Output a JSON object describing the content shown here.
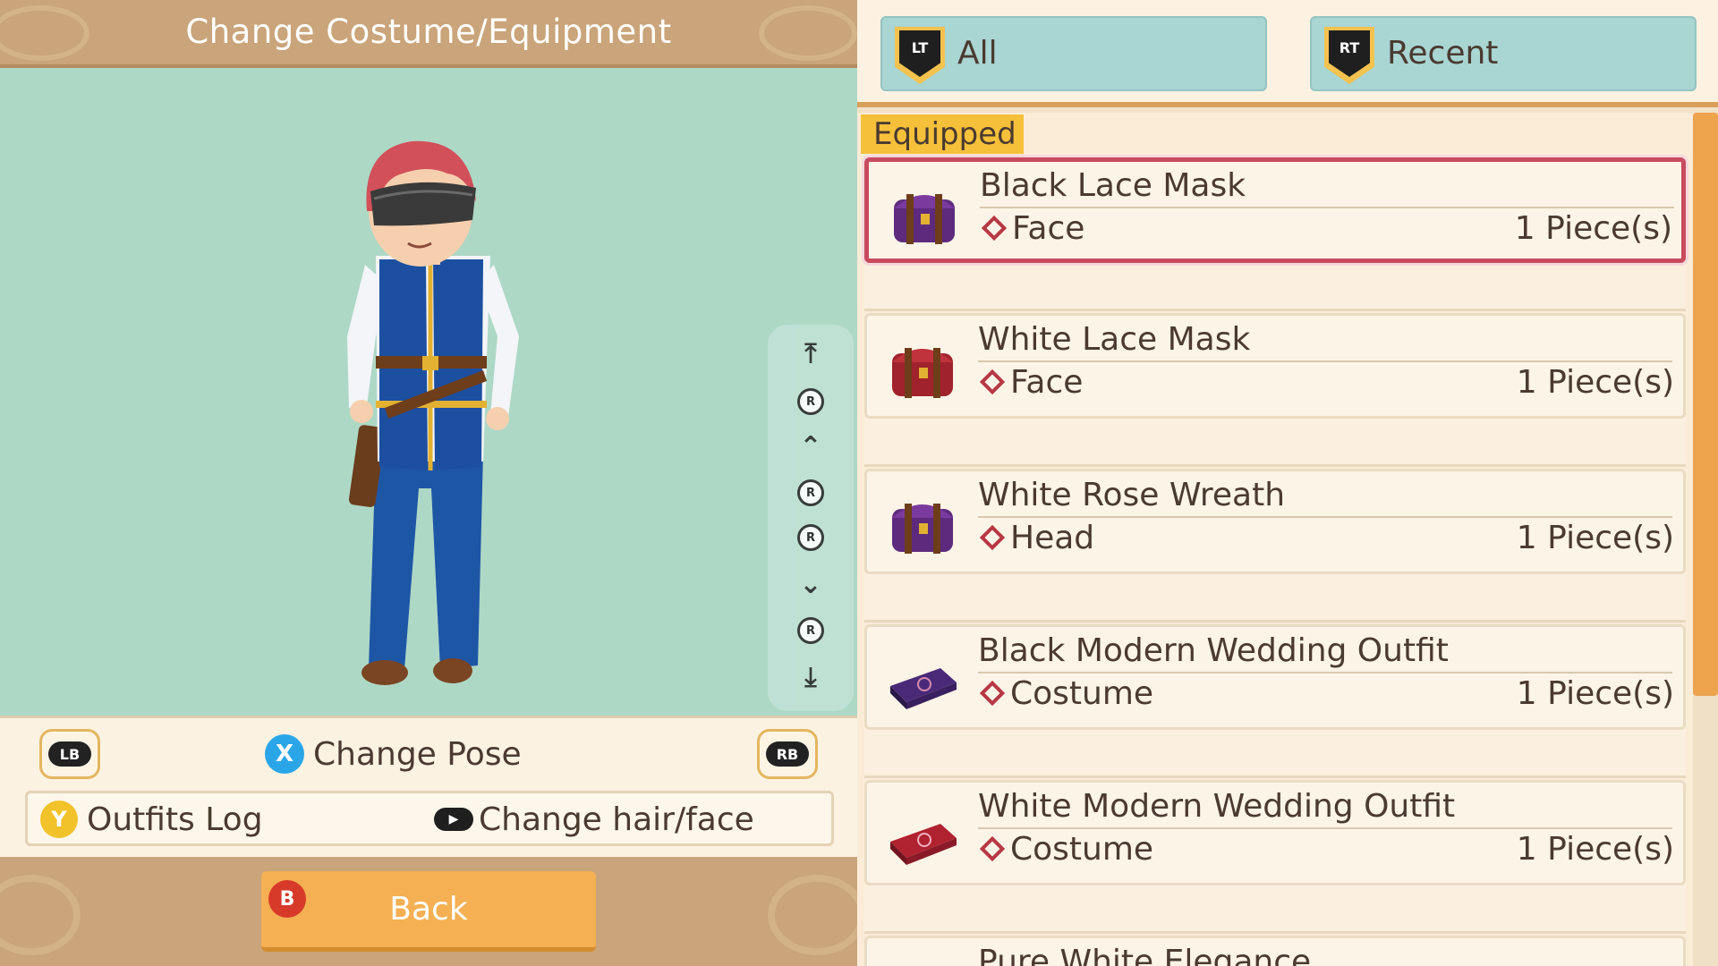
{
  "header": {
    "title": "Change Costume/Equipment"
  },
  "viewer": {
    "scroll_controls": [
      "scroll-to-top",
      "rotate-up",
      "zoom-in",
      "rotate-left",
      "rotate-right",
      "zoom-out",
      "rotate-down",
      "scroll-to-bottom"
    ],
    "r_label": "R"
  },
  "controls": {
    "lb": "LB",
    "rb": "RB",
    "x_button": "X",
    "change_pose": "Change Pose",
    "y_button": "Y",
    "outfits_log": "Outfits Log",
    "change_hair_face": "Change hair/face",
    "b_button": "B",
    "back": "Back"
  },
  "tabs": [
    {
      "key": "LT",
      "label": "All"
    },
    {
      "key": "RT",
      "label": "Recent"
    }
  ],
  "section_label": "Equipped",
  "items": [
    {
      "name": "Black Lace Mask",
      "slot": "Face",
      "qty": "1 Piece(s)",
      "icon": "purple-chest-icon",
      "color": "#5e2a7e",
      "selected": true
    },
    {
      "name": "White Lace Mask",
      "slot": "Face",
      "qty": "1 Piece(s)",
      "icon": "red-chest-icon",
      "color": "#a0222c",
      "selected": false
    },
    {
      "name": "White Rose Wreath",
      "slot": "Head",
      "qty": "1 Piece(s)",
      "icon": "purple-chest-icon",
      "color": "#5e2a7e",
      "selected": false
    },
    {
      "name": "Black Modern Wedding Outfit",
      "slot": "Costume",
      "qty": "1 Piece(s)",
      "icon": "purple-case-icon",
      "color": "#4a2a78",
      "selected": false
    },
    {
      "name": "White Modern Wedding Outfit",
      "slot": "Costume",
      "qty": "1 Piece(s)",
      "icon": "red-case-icon",
      "color": "#b02230",
      "selected": false
    },
    {
      "name": "Pure White Elegance",
      "slot": "",
      "qty": "",
      "icon": "",
      "color": "",
      "selected": false
    }
  ],
  "colors": {
    "accent": "#f4b052",
    "selected_border": "#c84a5e",
    "viewport_bg": "#aed8c6",
    "tab_bg": "#a9d5d3"
  }
}
